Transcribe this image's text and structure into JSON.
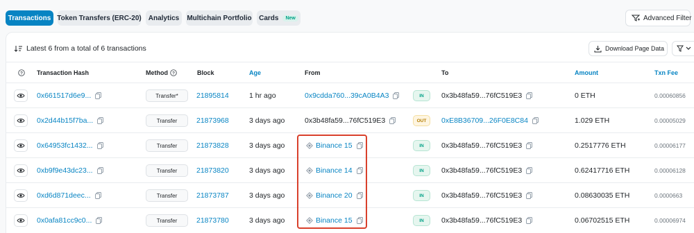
{
  "tabs": {
    "transactions": "Transactions",
    "token_transfers": "Token Transfers (ERC-20)",
    "analytics": "Analytics",
    "multichain": "Multichain Portfolio",
    "cards": "Cards",
    "cards_badge": "New"
  },
  "advanced_filter_label": "Advanced Filter",
  "summary_text": "Latest 6 from a total of 6 transactions",
  "download_label": "Download Page Data",
  "headers": {
    "hash": "Transaction Hash",
    "method": "Method",
    "block": "Block",
    "age": "Age",
    "from": "From",
    "to": "To",
    "amount": "Amount",
    "fee": "Txn Fee"
  },
  "rows": [
    {
      "hash": "0x661517d6e9...",
      "method": "Transfer*",
      "block": "21895814",
      "age": "1 hr ago",
      "from": "0x9cdda760...39cA0B4A3",
      "from_is_link": true,
      "direction": "IN",
      "to": "0x3b48fa59...76fC519E3",
      "to_is_link": false,
      "amount": "0 ETH",
      "fee": "0.00060856"
    },
    {
      "hash": "0x2d44b15f7ba...",
      "method": "Transfer",
      "block": "21873968",
      "age": "3 days ago",
      "from": "0x3b48fa59...76fC519E3",
      "from_is_link": false,
      "direction": "OUT",
      "to": "0xE8B36709...26F0E8C84",
      "to_is_link": true,
      "amount": "1.029 ETH",
      "fee": "0.00005029"
    },
    {
      "hash": "0x64953fc1432...",
      "method": "Transfer",
      "block": "21873828",
      "age": "3 days ago",
      "from": "Binance 15",
      "from_is_link": true,
      "direction": "IN",
      "to": "0x3b48fa59...76fC519E3",
      "to_is_link": false,
      "amount": "0.2517776 ETH",
      "fee": "0.00006177"
    },
    {
      "hash": "0xb9f9e43dc23...",
      "method": "Transfer",
      "block": "21873820",
      "age": "3 days ago",
      "from": "Binance 14",
      "from_is_link": true,
      "direction": "IN",
      "to": "0x3b48fa59...76fC519E3",
      "to_is_link": false,
      "amount": "0.62417716 ETH",
      "fee": "0.00006128"
    },
    {
      "hash": "0xd6d871deec...",
      "method": "Transfer",
      "block": "21873787",
      "age": "3 days ago",
      "from": "Binance 20",
      "from_is_link": true,
      "direction": "IN",
      "to": "0x3b48fa59...76fC519E3",
      "to_is_link": false,
      "amount": "0.08630035 ETH",
      "fee": "0.0000663"
    },
    {
      "hash": "0x0afa81cc9c0...",
      "method": "Transfer",
      "block": "21873780",
      "age": "3 days ago",
      "from": "Binance 15",
      "from_is_link": true,
      "direction": "IN",
      "to": "0x3b48fa59...76fC519E3",
      "to_is_link": false,
      "amount": "0.06702515 ETH",
      "fee": "0.00006974"
    }
  ],
  "colors": {
    "accent": "#0784c3",
    "in_badge": "#00a186",
    "out_badge": "#b47d00",
    "highlight": "#d9402b"
  },
  "icons": [
    "eye-icon",
    "copy-icon",
    "info-icon",
    "sort-icon",
    "download-icon",
    "filter-icon",
    "chevron-down-icon",
    "exchange-icon"
  ]
}
